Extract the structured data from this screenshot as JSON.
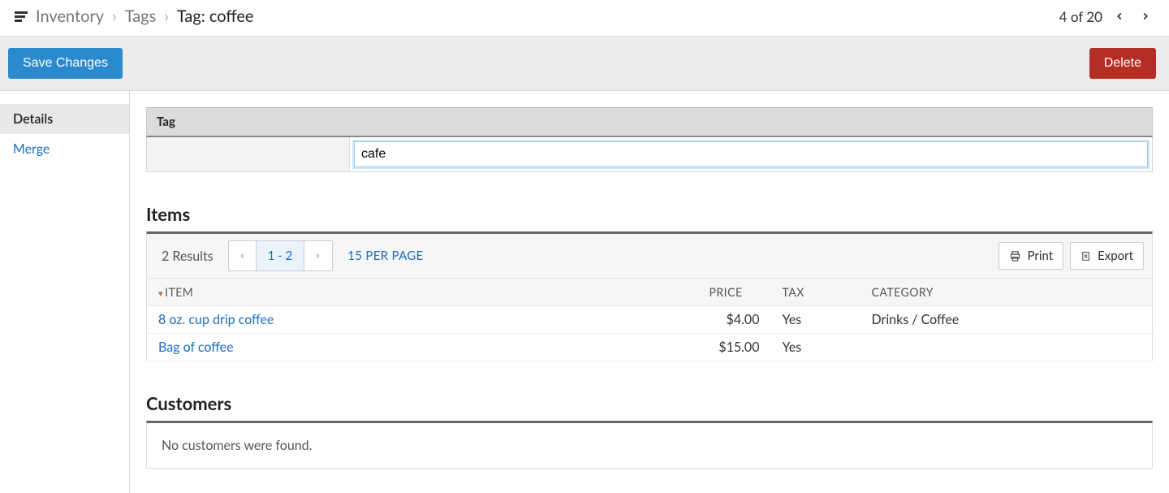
{
  "breadcrumb": {
    "inventory": "Inventory",
    "tags": "Tags",
    "current_prefix": "Tag:",
    "current_value": "coffee"
  },
  "pager": {
    "label": "4 of 20"
  },
  "actions": {
    "save": "Save Changes",
    "delete": "Delete"
  },
  "sidebar": {
    "details": "Details",
    "merge": "Merge"
  },
  "tag_panel": {
    "header": "Tag",
    "input_value": "cafe"
  },
  "items_section": {
    "heading": "Items",
    "results": "2 Results",
    "range": "1 - 2",
    "per_page": "15 PER PAGE",
    "print": "Print",
    "export": "Export",
    "col_item": "ITEM",
    "col_price": "PRICE",
    "col_tax": "TAX",
    "col_category": "CATEGORY",
    "rows": [
      {
        "item": "8 oz. cup drip coffee",
        "price": "$4.00",
        "tax": "Yes",
        "category": "Drinks / Coffee"
      },
      {
        "item": "Bag of coffee",
        "price": "$15.00",
        "tax": "Yes",
        "category": ""
      }
    ]
  },
  "customers_section": {
    "heading": "Customers",
    "empty": "No customers were found."
  }
}
